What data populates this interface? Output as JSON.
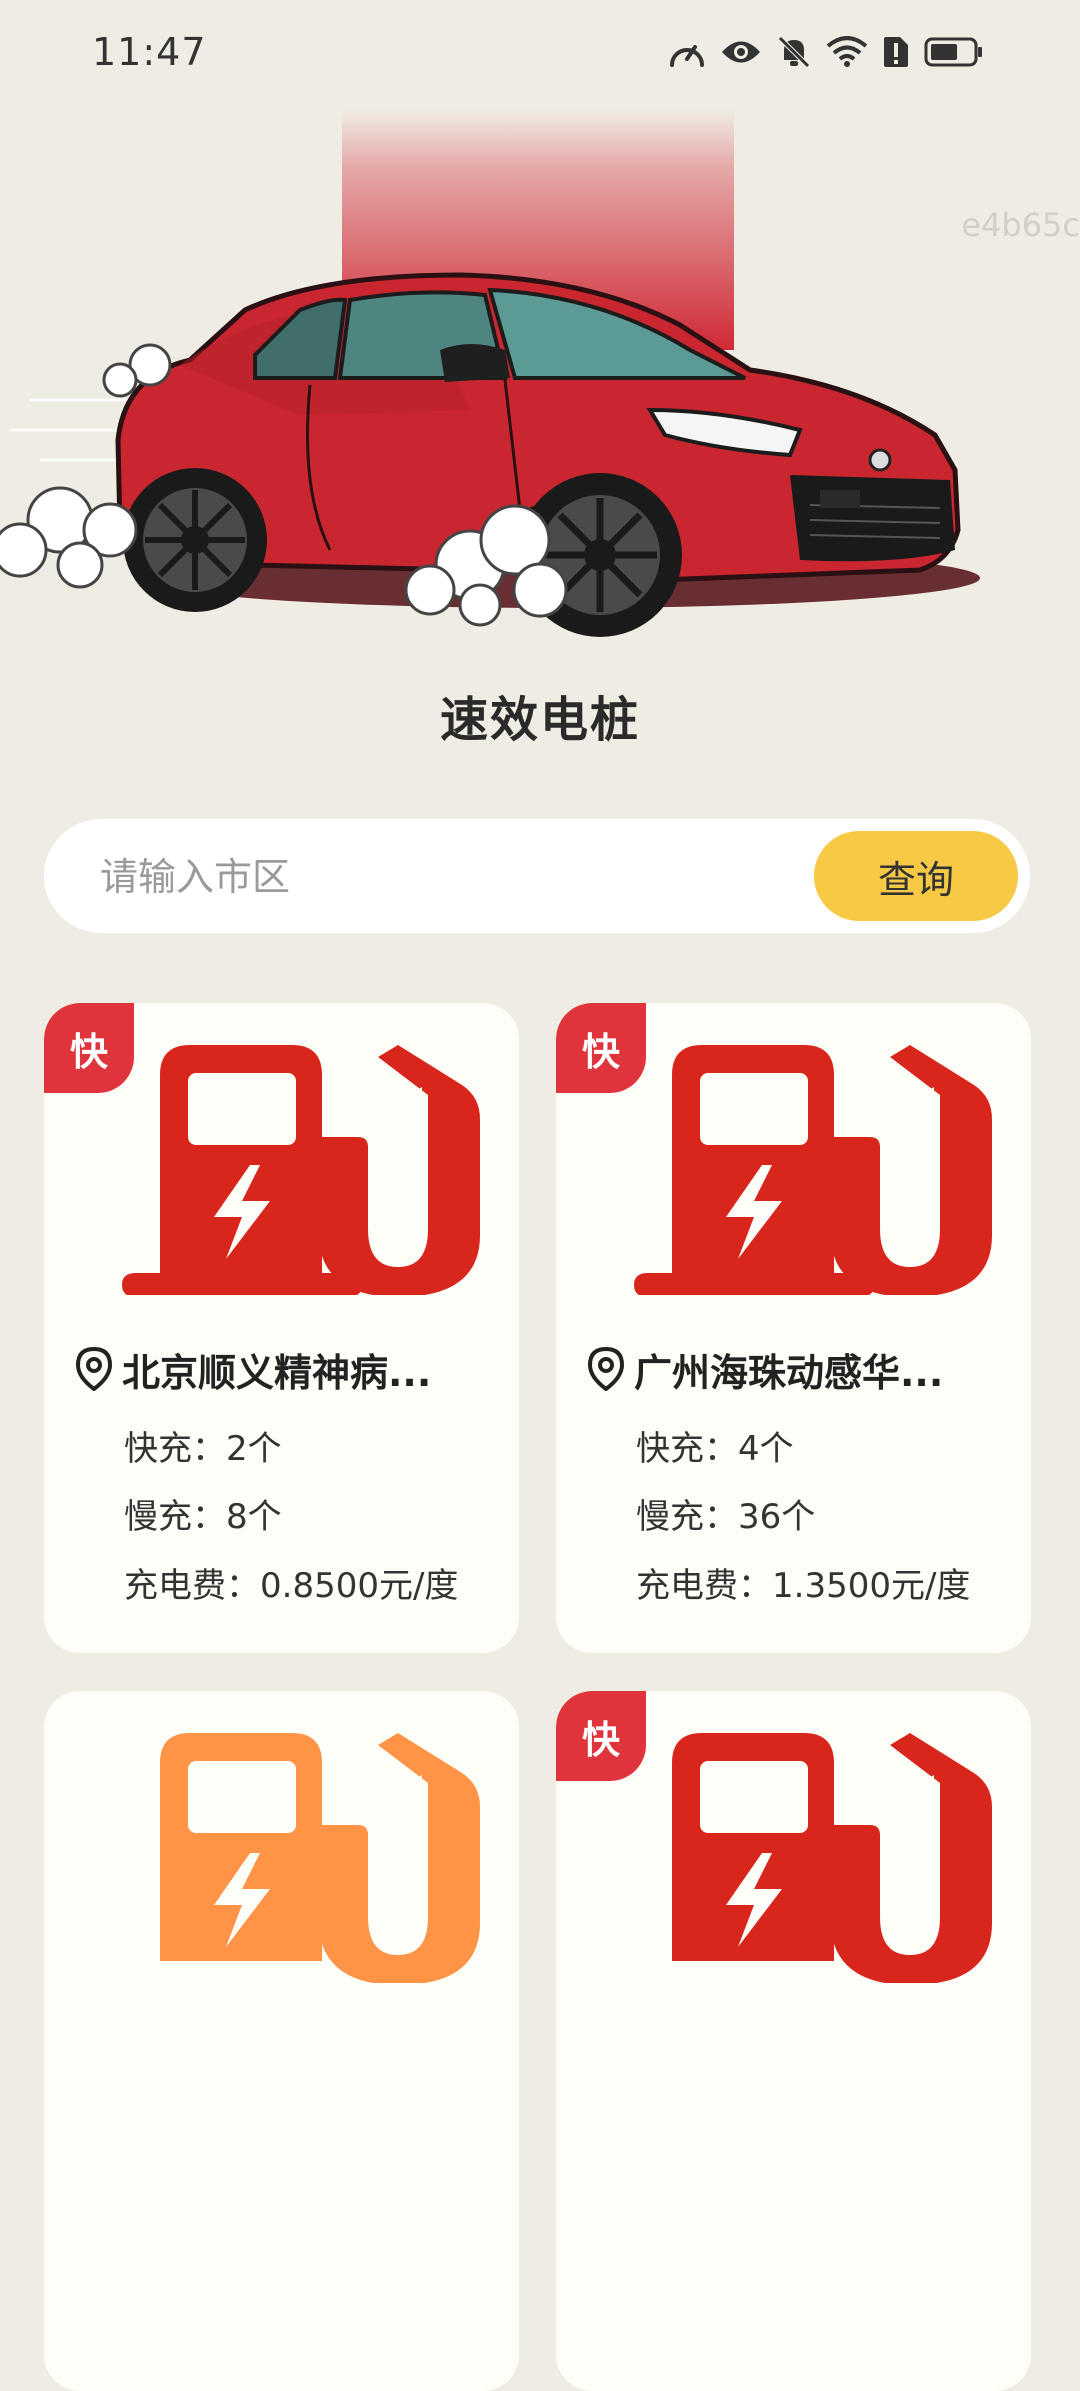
{
  "status_bar": {
    "time": "11:47",
    "icons": [
      "speedometer-icon",
      "eye-icon",
      "bell-off-icon",
      "wifi-icon",
      "sim-alert-icon",
      "battery-icon"
    ]
  },
  "watermark": "e4b65c",
  "app_title": "速效电桩",
  "search": {
    "placeholder": "请输入市区",
    "value": "",
    "button_label": "查询"
  },
  "colors": {
    "background": "#efece3",
    "accent_yellow": "#f7c945",
    "badge_red": "#e0343d",
    "pump_red": "#d9261c",
    "pump_orange": "#ff9447"
  },
  "stations": [
    {
      "badge": "快",
      "name": "北京顺义精神病...",
      "fast_label": "快充：",
      "fast_value": "2个",
      "slow_label": "慢充：",
      "slow_value": "8个",
      "fee_label": "充电费：",
      "fee_value": "0.8500元/度",
      "icon_color": "red"
    },
    {
      "badge": "快",
      "name": "广州海珠动感华...",
      "fast_label": "快充：",
      "fast_value": "4个",
      "slow_label": "慢充：",
      "slow_value": "36个",
      "fee_label": "充电费：",
      "fee_value": "1.3500元/度",
      "icon_color": "red"
    },
    {
      "badge": "",
      "icon_color": "orange"
    },
    {
      "badge": "快",
      "icon_color": "red"
    }
  ]
}
